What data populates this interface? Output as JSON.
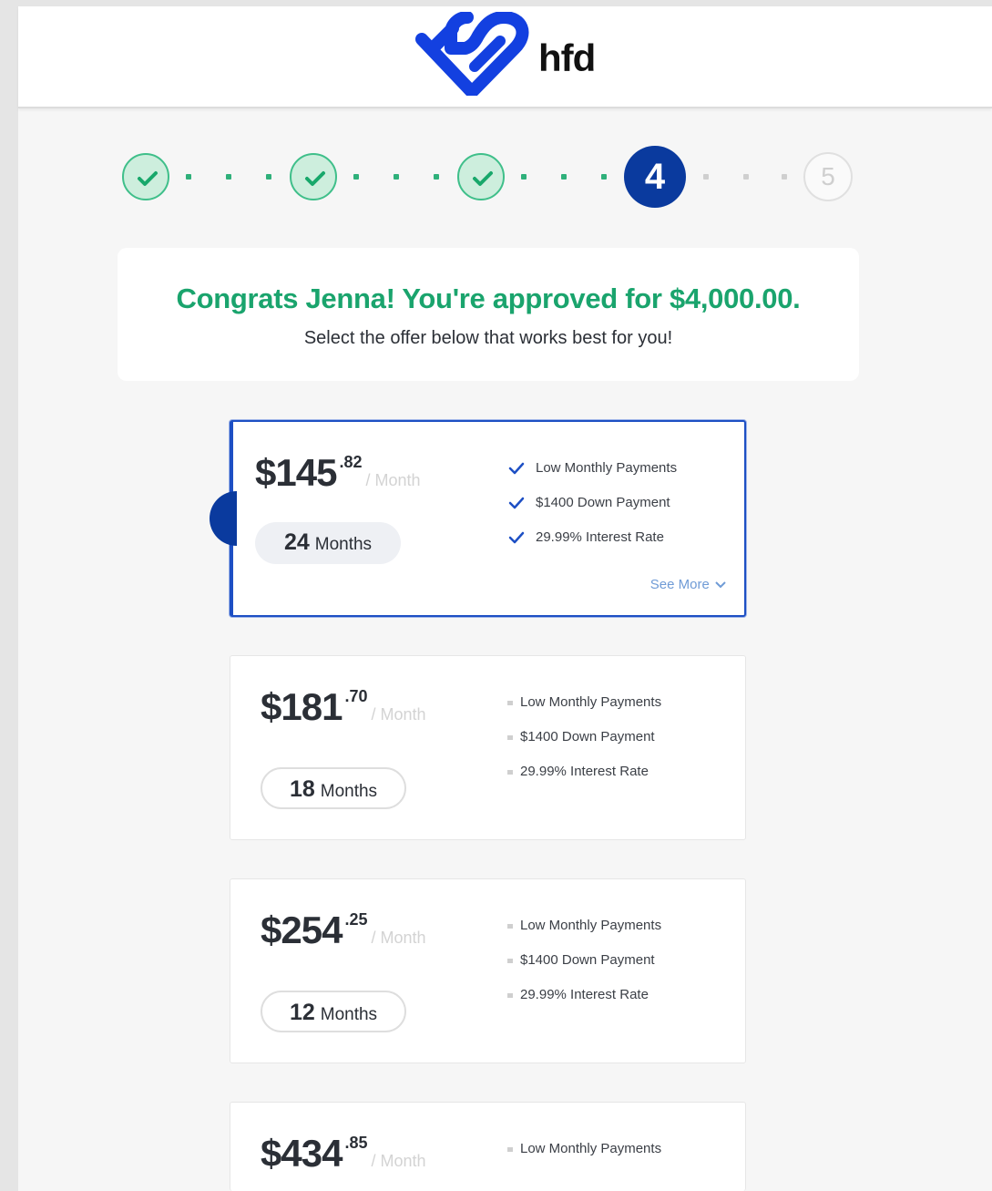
{
  "brand": {
    "name": "hfd"
  },
  "stepper": {
    "steps": [
      {
        "state": "done"
      },
      {
        "state": "done"
      },
      {
        "state": "done"
      },
      {
        "state": "current",
        "label": "4"
      },
      {
        "state": "upcoming",
        "label": "5"
      }
    ]
  },
  "congrats": {
    "title": "Congrats Jenna! You're approved for $4,000.00.",
    "subtitle": "Select the offer below that works best for you!"
  },
  "offers": [
    {
      "price": "$145",
      "cents": ".82",
      "unit": "/ Month",
      "term_number": "24",
      "term_label": "Months",
      "features": [
        "Low Monthly Payments",
        "$1400 Down Payment",
        "29.99% Interest Rate"
      ],
      "see_more": "See More",
      "selected": true
    },
    {
      "price": "$181",
      "cents": ".70",
      "unit": "/ Month",
      "term_number": "18",
      "term_label": "Months",
      "features": [
        "Low Monthly Payments",
        "$1400 Down Payment",
        "29.99% Interest Rate"
      ],
      "selected": false
    },
    {
      "price": "$254",
      "cents": ".25",
      "unit": "/ Month",
      "term_number": "12",
      "term_label": "Months",
      "features": [
        "Low Monthly Payments",
        "$1400 Down Payment",
        "29.99% Interest Rate"
      ],
      "selected": false
    },
    {
      "price": "$434",
      "cents": ".85",
      "unit": "/ Month",
      "features": [
        "Low Monthly Payments"
      ],
      "selected": false
    }
  ],
  "colors": {
    "brand_blue": "#0a3a9e",
    "success_green": "#1aa46d",
    "selected_border": "#1d4fc4"
  }
}
